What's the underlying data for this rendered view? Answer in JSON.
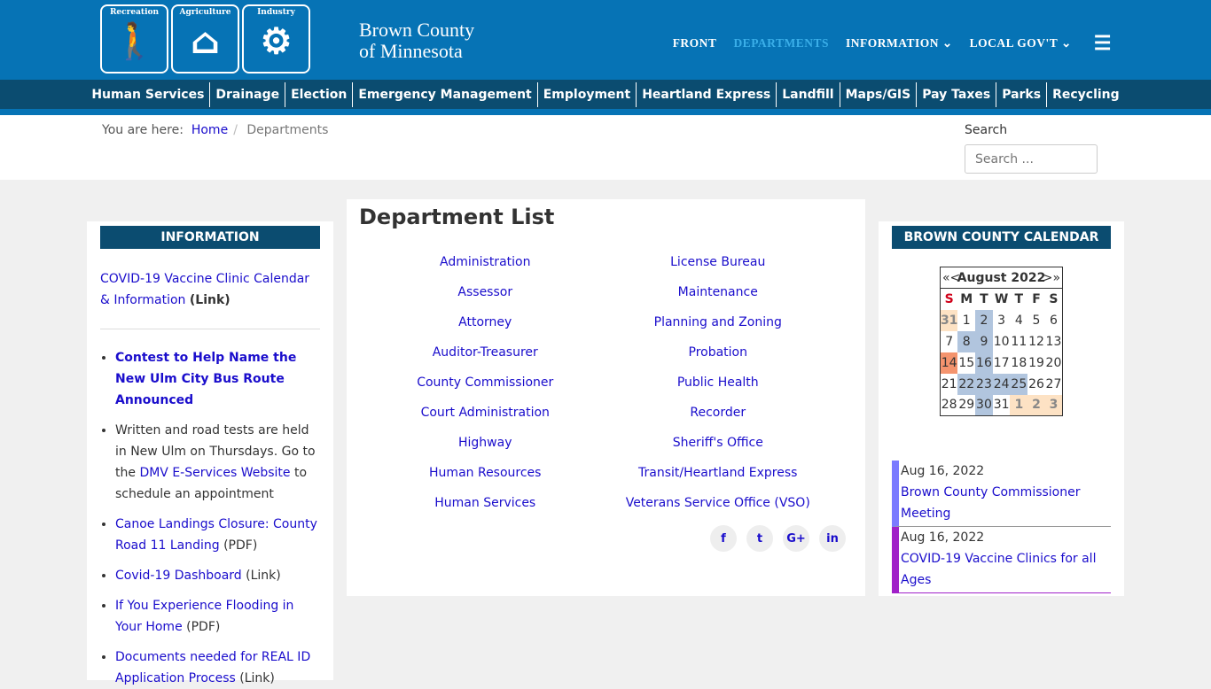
{
  "header": {
    "logo_panels": [
      "Recreation",
      "Agriculture",
      "Industry"
    ],
    "brand_line1": "Brown County",
    "brand_line2": "of Minnesota",
    "nav": [
      {
        "label": "FRONT"
      },
      {
        "label": "DEPARTMENTS",
        "active": true
      },
      {
        "label": "INFORMATION ⌄"
      },
      {
        "label": "LOCAL GOV'T ⌄"
      }
    ]
  },
  "subnav": [
    "Human Services",
    "Drainage",
    "Election",
    "Emergency Management",
    "Employment",
    "Heartland Express",
    "Landfill",
    "Maps/GIS",
    "Pay Taxes",
    "Parks",
    "Recycling"
  ],
  "breadcrumb": {
    "prefix": "You are here:",
    "home": "Home",
    "current": "Departments"
  },
  "search": {
    "label": "Search",
    "placeholder": "Search ..."
  },
  "left": {
    "title": "INFORMATION",
    "intro_link": "COVID-19 Vaccine Clinic Calendar & Information",
    "intro_suffix": "(Link)",
    "items": [
      {
        "pre": "",
        "link": "Contest to Help Name the New Ulm City Bus Route Announced",
        "post": "",
        "bold": true
      },
      {
        "pre": "Written and road tests are held in New Ulm on Thursdays. Go to the ",
        "link": "DMV E-Services Website",
        "post": " to schedule an appointment"
      },
      {
        "pre": "",
        "link": "Canoe Landings Closure: County Road 11 Landing",
        "post": " (PDF)"
      },
      {
        "pre": "",
        "link": "Covid-19 Dashboard",
        "post": " (Link)"
      },
      {
        "pre": "",
        "link": "If You Experience Flooding in Your Home",
        "post": " (PDF)"
      },
      {
        "pre": "",
        "link": "Documents needed for REAL ID Application Process",
        "post": " (Link)"
      }
    ]
  },
  "main": {
    "title": "Department List",
    "col1": [
      "Administration",
      "Assessor",
      "Attorney",
      "Auditor-Treasurer",
      "County Commissioner",
      "Court Administration",
      "Highway",
      "Human Resources",
      "Human Services"
    ],
    "col2": [
      "License Bureau",
      "Maintenance",
      "Planning and Zoning",
      "Probation",
      "Public Health",
      "Recorder",
      "Sheriff's Office",
      "Transit/Heartland Express",
      "Veterans Service Office (VSO)"
    ],
    "social": [
      {
        "icon": "facebook-icon",
        "glyph": "f"
      },
      {
        "icon": "twitter-icon",
        "glyph": "t"
      },
      {
        "icon": "google-plus-icon",
        "glyph": "G+"
      },
      {
        "icon": "linkedin-icon",
        "glyph": "in"
      }
    ]
  },
  "calendar": {
    "title": "BROWN COUNTY CALENDAR",
    "month": "August 2022",
    "prev": "«<",
    "next": ">»",
    "dow": [
      "S",
      "M",
      "T",
      "W",
      "T",
      "F",
      "S"
    ],
    "weeks": [
      [
        [
          "31",
          "other"
        ],
        [
          "1",
          ""
        ],
        [
          "2",
          "event"
        ],
        [
          "3",
          ""
        ],
        [
          "4",
          ""
        ],
        [
          "5",
          ""
        ],
        [
          "6",
          ""
        ]
      ],
      [
        [
          "7",
          ""
        ],
        [
          "8",
          "event"
        ],
        [
          "9",
          "event"
        ],
        [
          "10",
          ""
        ],
        [
          "11",
          ""
        ],
        [
          "12",
          ""
        ],
        [
          "13",
          ""
        ]
      ],
      [
        [
          "14",
          "today"
        ],
        [
          "15",
          ""
        ],
        [
          "16",
          "event"
        ],
        [
          "17",
          ""
        ],
        [
          "18",
          ""
        ],
        [
          "19",
          ""
        ],
        [
          "20",
          ""
        ]
      ],
      [
        [
          "21",
          ""
        ],
        [
          "22",
          "event"
        ],
        [
          "23",
          "event"
        ],
        [
          "24",
          "event"
        ],
        [
          "25",
          "event"
        ],
        [
          "26",
          ""
        ],
        [
          "27",
          ""
        ]
      ],
      [
        [
          "28",
          ""
        ],
        [
          "29",
          ""
        ],
        [
          "30",
          "event"
        ],
        [
          "31",
          ""
        ],
        [
          "1",
          "other"
        ],
        [
          "2",
          "other"
        ],
        [
          "3",
          "other"
        ]
      ]
    ],
    "colors": {
      "event": "#b1c5de",
      "today": "#f4946e",
      "other": "#fde2c4"
    },
    "events": [
      {
        "date": "Aug 16, 2022",
        "title": "Brown County Commissioner Meeting",
        "color": "#7b7bff"
      },
      {
        "date": "Aug 16, 2022",
        "title": "COVID-19 Vaccine Clinics for all Ages",
        "color": "#a020c8"
      }
    ]
  }
}
